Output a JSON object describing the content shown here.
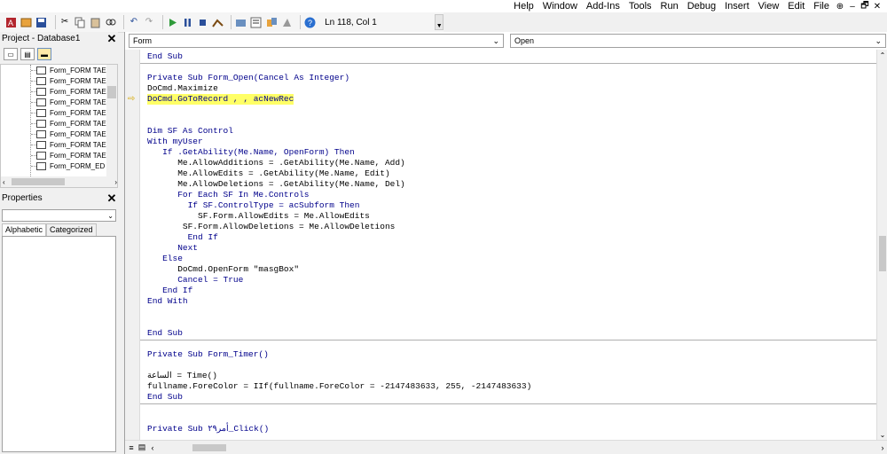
{
  "menu": {
    "items": [
      "Help",
      "Window",
      "Add-Ins",
      "Tools",
      "Run",
      "Debug",
      "Insert",
      "View",
      "Edit",
      "File"
    ],
    "window_controls": [
      "⊕",
      "–",
      "🗗",
      "✕"
    ]
  },
  "toolbar": {
    "buttons": [
      "access-icon",
      "insert-module-icon",
      "save-icon",
      "cut-icon",
      "copy-icon",
      "paste-icon",
      "find-icon",
      "undo-icon",
      "redo-icon",
      "run-icon",
      "break-icon",
      "reset-icon",
      "design-mode-icon",
      "project-explorer-icon",
      "properties-icon",
      "object-browser-icon",
      "toolbox-icon",
      "help-icon"
    ],
    "position": "Ln 118, Col 1"
  },
  "project": {
    "title": "Project - Database1",
    "close": "✕",
    "tree_items": [
      "Form_FORM TAE",
      "Form_FORM TAE",
      "Form_FORM TAE",
      "Form_FORM TAE",
      "Form_FORM TAE",
      "Form_FORM TAE",
      "Form_FORM TAE",
      "Form_FORM TAE",
      "Form_FORM TAE",
      "Form_FORM_ED"
    ]
  },
  "properties": {
    "title": "Properties",
    "close": "✕",
    "tabs": [
      "Alphabetic",
      "Categorized"
    ]
  },
  "code": {
    "object_combo": "Form",
    "procedure_combo": "Open",
    "lines": [
      {
        "text": "End Sub",
        "kw": true
      },
      {
        "text": "",
        "kw": false
      },
      {
        "text": "Private Sub Form_Open(Cancel As Integer)",
        "kw": true
      },
      {
        "text": "DoCmd.Maximize",
        "kw": false
      },
      {
        "text": "DoCmd.GoToRecord , , acNewRec",
        "kw": false,
        "highlight": true
      },
      {
        "text": "",
        "kw": false
      },
      {
        "text": "",
        "kw": false
      },
      {
        "text": "Dim SF As Control",
        "kw": true
      },
      {
        "text": "With myUser",
        "kw": true
      },
      {
        "text": "   If .GetAbility(Me.Name, OpenForm) Then",
        "kw": true
      },
      {
        "text": "      Me.AllowAdditions = .GetAbility(Me.Name, Add)",
        "kw": false
      },
      {
        "text": "      Me.AllowEdits = .GetAbility(Me.Name, Edit)",
        "kw": false
      },
      {
        "text": "      Me.AllowDeletions = .GetAbility(Me.Name, Del)",
        "kw": false
      },
      {
        "text": "      For Each SF In Me.Controls",
        "kw": true
      },
      {
        "text": "        If SF.ControlType = acSubform Then",
        "kw": true
      },
      {
        "text": "          SF.Form.AllowEdits = Me.AllowEdits",
        "kw": false
      },
      {
        "text": "       SF.Form.AllowDeletions = Me.AllowDeletions",
        "kw": false
      },
      {
        "text": "        End If",
        "kw": true
      },
      {
        "text": "      Next",
        "kw": true
      },
      {
        "text": "   Else",
        "kw": true
      },
      {
        "text": "      DoCmd.OpenForm \"masgBox\"",
        "kw": false
      },
      {
        "text": "      Cancel = True",
        "kw": true
      },
      {
        "text": "   End If",
        "kw": true
      },
      {
        "text": "End With",
        "kw": true
      },
      {
        "text": "",
        "kw": false
      },
      {
        "text": "",
        "kw": false
      },
      {
        "text": "End Sub",
        "kw": true
      },
      {
        "text": "",
        "kw": false
      },
      {
        "text": "Private Sub Form_Timer()",
        "kw": true
      },
      {
        "text": "",
        "kw": false
      },
      {
        "text": "الساعة = Time()",
        "kw": false
      },
      {
        "text": "fullname.ForeColor = IIf(fullname.ForeColor = -2147483633, 255, -2147483633)",
        "kw": false
      },
      {
        "text": "End Sub",
        "kw": true
      },
      {
        "text": "",
        "kw": false
      },
      {
        "text": "",
        "kw": false
      },
      {
        "text": "Private Sub أمر٢٩_Click()",
        "kw": true
      }
    ]
  },
  "colors": {
    "keyword": "#00008b",
    "highlight": "#ffff66",
    "arrow": "#d6a800"
  }
}
